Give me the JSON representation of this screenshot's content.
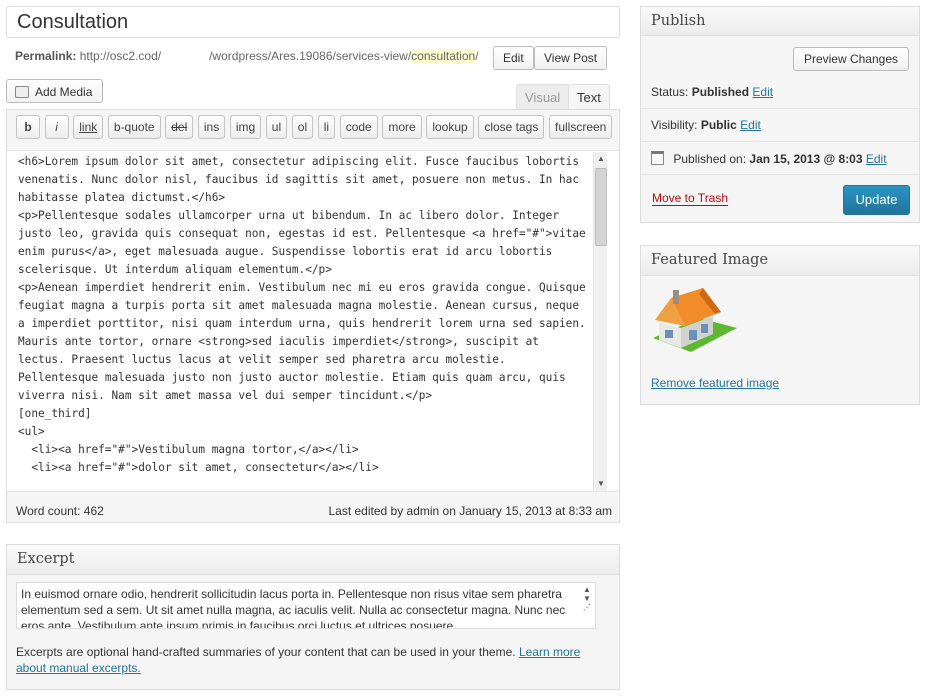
{
  "post": {
    "title": "Consultation",
    "permalink_label": "Permalink:",
    "permalink_prefix": "http://osc2.cod/",
    "permalink_path": "/wordpress/Ares.19086/services-view/",
    "permalink_slug": "consultation",
    "permalink_suffix": "/",
    "edit_label": "Edit",
    "view_post_label": "View Post"
  },
  "editor": {
    "add_media_label": "Add Media",
    "tabs": {
      "visual": "Visual",
      "text": "Text"
    },
    "quicktags": [
      "b",
      "i",
      "link",
      "b-quote",
      "del",
      "ins",
      "img",
      "ul",
      "ol",
      "li",
      "code",
      "more",
      "lookup",
      "close tags",
      "fullscreen"
    ],
    "content": "<h6>Lorem ipsum dolor sit amet, consectetur adipiscing elit. Fusce faucibus lobortis venenatis. Nunc dolor nisl, faucibus id sagittis sit amet, posuere non metus. In hac habitasse platea dictumst.</h6>\n<p>Pellentesque sodales ullamcorper urna ut bibendum. In ac libero dolor. Integer justo leo, gravida quis consequat non, egestas id est. Pellentesque <a href=\"#\">vitae enim purus</a>, eget malesuada augue. Suspendisse lobortis erat id arcu lobortis scelerisque. Ut interdum aliquam elementum.</p>\n<p>Aenean imperdiet hendrerit enim. Vestibulum nec mi eu eros gravida congue. Quisque feugiat magna a turpis porta sit amet malesuada magna molestie. Aenean cursus, neque a imperdiet porttitor, nisi quam interdum urna, quis hendrerit lorem urna sed sapien. Mauris ante tortor, ornare <strong>sed iaculis imperdiet</strong>, suscipit at lectus. Praesent luctus lacus at velit semper sed pharetra arcu molestie. Pellentesque malesuada justo non justo auctor molestie. Etiam quis quam arcu, quis viverra nisi. Nam sit amet massa vel dui semper tincidunt.</p>\n[one_third]\n<ul>\n  <li><a href=\"#\">Vestibulum magna tortor,</a></li>\n  <li><a href=\"#\">dolor sit amet, consectetur</a></li>",
    "word_count": "Word count: 462",
    "last_edited": "Last edited by admin on January 15, 2013 at 8:33 am"
  },
  "excerpt": {
    "title": "Excerpt",
    "text": "In euismod ornare odio, hendrerit sollicitudin lacus porta in. Pellentesque non risus vitae sem pharetra elementum sed a sem. Ut sit amet nulla magna, ac iaculis velit. Nulla ac consectetur magna. Nunc nec eros ante. Vestibulum ante ipsum primis in faucibus orci luctus et ultrices posuere",
    "help_text": "Excerpts are optional hand-crafted summaries of your content that can be used in your theme. ",
    "help_link": "Learn more about manual excerpts."
  },
  "publish": {
    "title": "Publish",
    "preview_label": "Preview Changes",
    "status_label": "Status:",
    "status_value": "Published",
    "visibility_label": "Visibility:",
    "visibility_value": "Public",
    "published_on_label": "Published on:",
    "published_on_value": "Jan 15, 2013 @ 8:03",
    "edit_label": "Edit",
    "trash_label": "Move to Trash",
    "update_label": "Update"
  },
  "featured_image": {
    "title": "Featured Image",
    "remove_label": "Remove featured image"
  },
  "colors": {
    "link": "#21759b",
    "update_button": "#21759b",
    "trash": "#bc0b0b",
    "slug_highlight": "#fffbcc"
  }
}
